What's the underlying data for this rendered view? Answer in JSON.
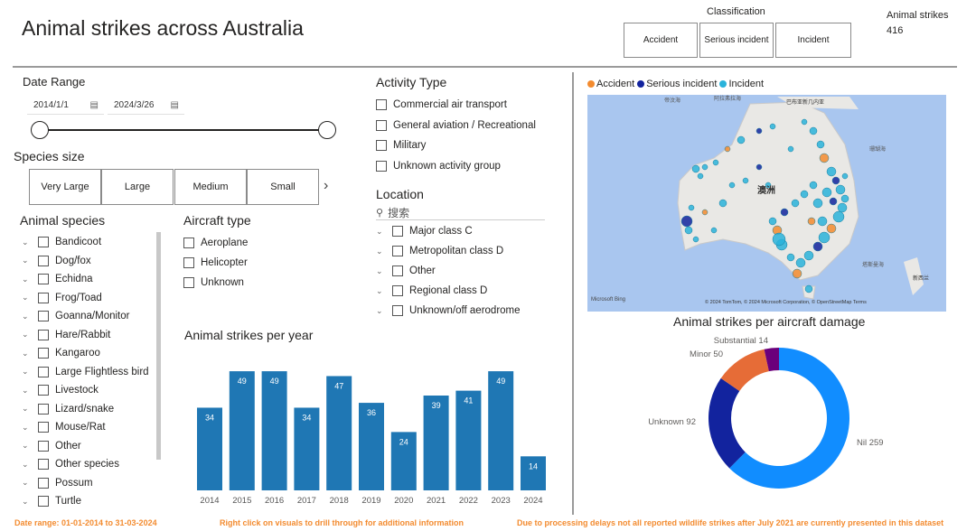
{
  "title": "Animal strikes across Australia",
  "classification": {
    "label": "Classification",
    "buttons": [
      "Accident",
      "Serious incident",
      "Incident"
    ]
  },
  "kpi": {
    "label": "Animal strikes",
    "value": "416"
  },
  "date_range": {
    "heading": "Date Range",
    "start": "2014/1/1",
    "end": "2024/3/26",
    "calendar_icon": "calendar-icon"
  },
  "species_size": {
    "heading": "Species size",
    "options": [
      "Very Large",
      "Large",
      "Medium",
      "Small"
    ],
    "more_icon": "chevron-right-icon"
  },
  "animal_species": {
    "heading": "Animal species",
    "items": [
      "Bandicoot",
      "Dog/fox",
      "Echidna",
      "Frog/Toad",
      "Goanna/Monitor",
      "Hare/Rabbit",
      "Kangaroo",
      "Large Flightless bird",
      "Livestock",
      "Lizard/snake",
      "Mouse/Rat",
      "Other",
      "Other species",
      "Possum",
      "Turtle"
    ]
  },
  "aircraft_type": {
    "heading": "Aircraft type",
    "items": [
      "Aeroplane",
      "Helicopter",
      "Unknown"
    ]
  },
  "activity_type": {
    "heading": "Activity Type",
    "items": [
      "Commercial air transport",
      "General aviation / Recreational",
      "Military",
      "Unknown activity group"
    ]
  },
  "location": {
    "heading": "Location",
    "search_placeholder": "搜索",
    "items": [
      "Major class C",
      "Metropolitan class D",
      "Other",
      "Regional class D",
      "Unknown/off aerodrome"
    ]
  },
  "map": {
    "legend": [
      {
        "label": "Accident",
        "color": "#f38b2f"
      },
      {
        "label": "Serious incident",
        "color": "#12239e"
      },
      {
        "label": "Incident",
        "color": "#2ab3db"
      }
    ],
    "labels": {
      "country": "澳洲",
      "north_sea_1": "帝汶海",
      "north_sea_2": "阿拉弗拉海",
      "png": "巴布亚新几内亚",
      "coral_sea": "珊瑚海",
      "tasman_sea": "塔斯曼海",
      "nz": "新西兰"
    },
    "bing": "Microsoft Bing",
    "copyright": "© 2024 TomTom, © 2024 Microsoft Corporation, © OpenStreetMap  Terms"
  },
  "chart_data": [
    {
      "type": "bar",
      "title": "Animal strikes per year",
      "categories": [
        "2014",
        "2015",
        "2016",
        "2017",
        "2018",
        "2019",
        "2020",
        "2021",
        "2022",
        "2023",
        "2024"
      ],
      "values": [
        34,
        49,
        49,
        34,
        47,
        36,
        24,
        39,
        41,
        49,
        14
      ],
      "color": "#1f77b4",
      "ylim": [
        0,
        52
      ]
    },
    {
      "type": "pie",
      "title": "Animal strikes per aircraft damage",
      "categories": [
        "Nil",
        "Unknown",
        "Minor",
        "Substantial"
      ],
      "values": [
        259,
        92,
        50,
        14
      ],
      "colors": [
        "#118dff",
        "#12239e",
        "#e66c37",
        "#6b007b"
      ]
    }
  ],
  "footer": {
    "left": "Date range: 01-01-2014 to 31-03-2024",
    "middle": "Right click on visuals to drill through for additional information",
    "right": "Due to processing delays not all reported wildlife strikes after July 2021 are currently presented in this dataset"
  }
}
